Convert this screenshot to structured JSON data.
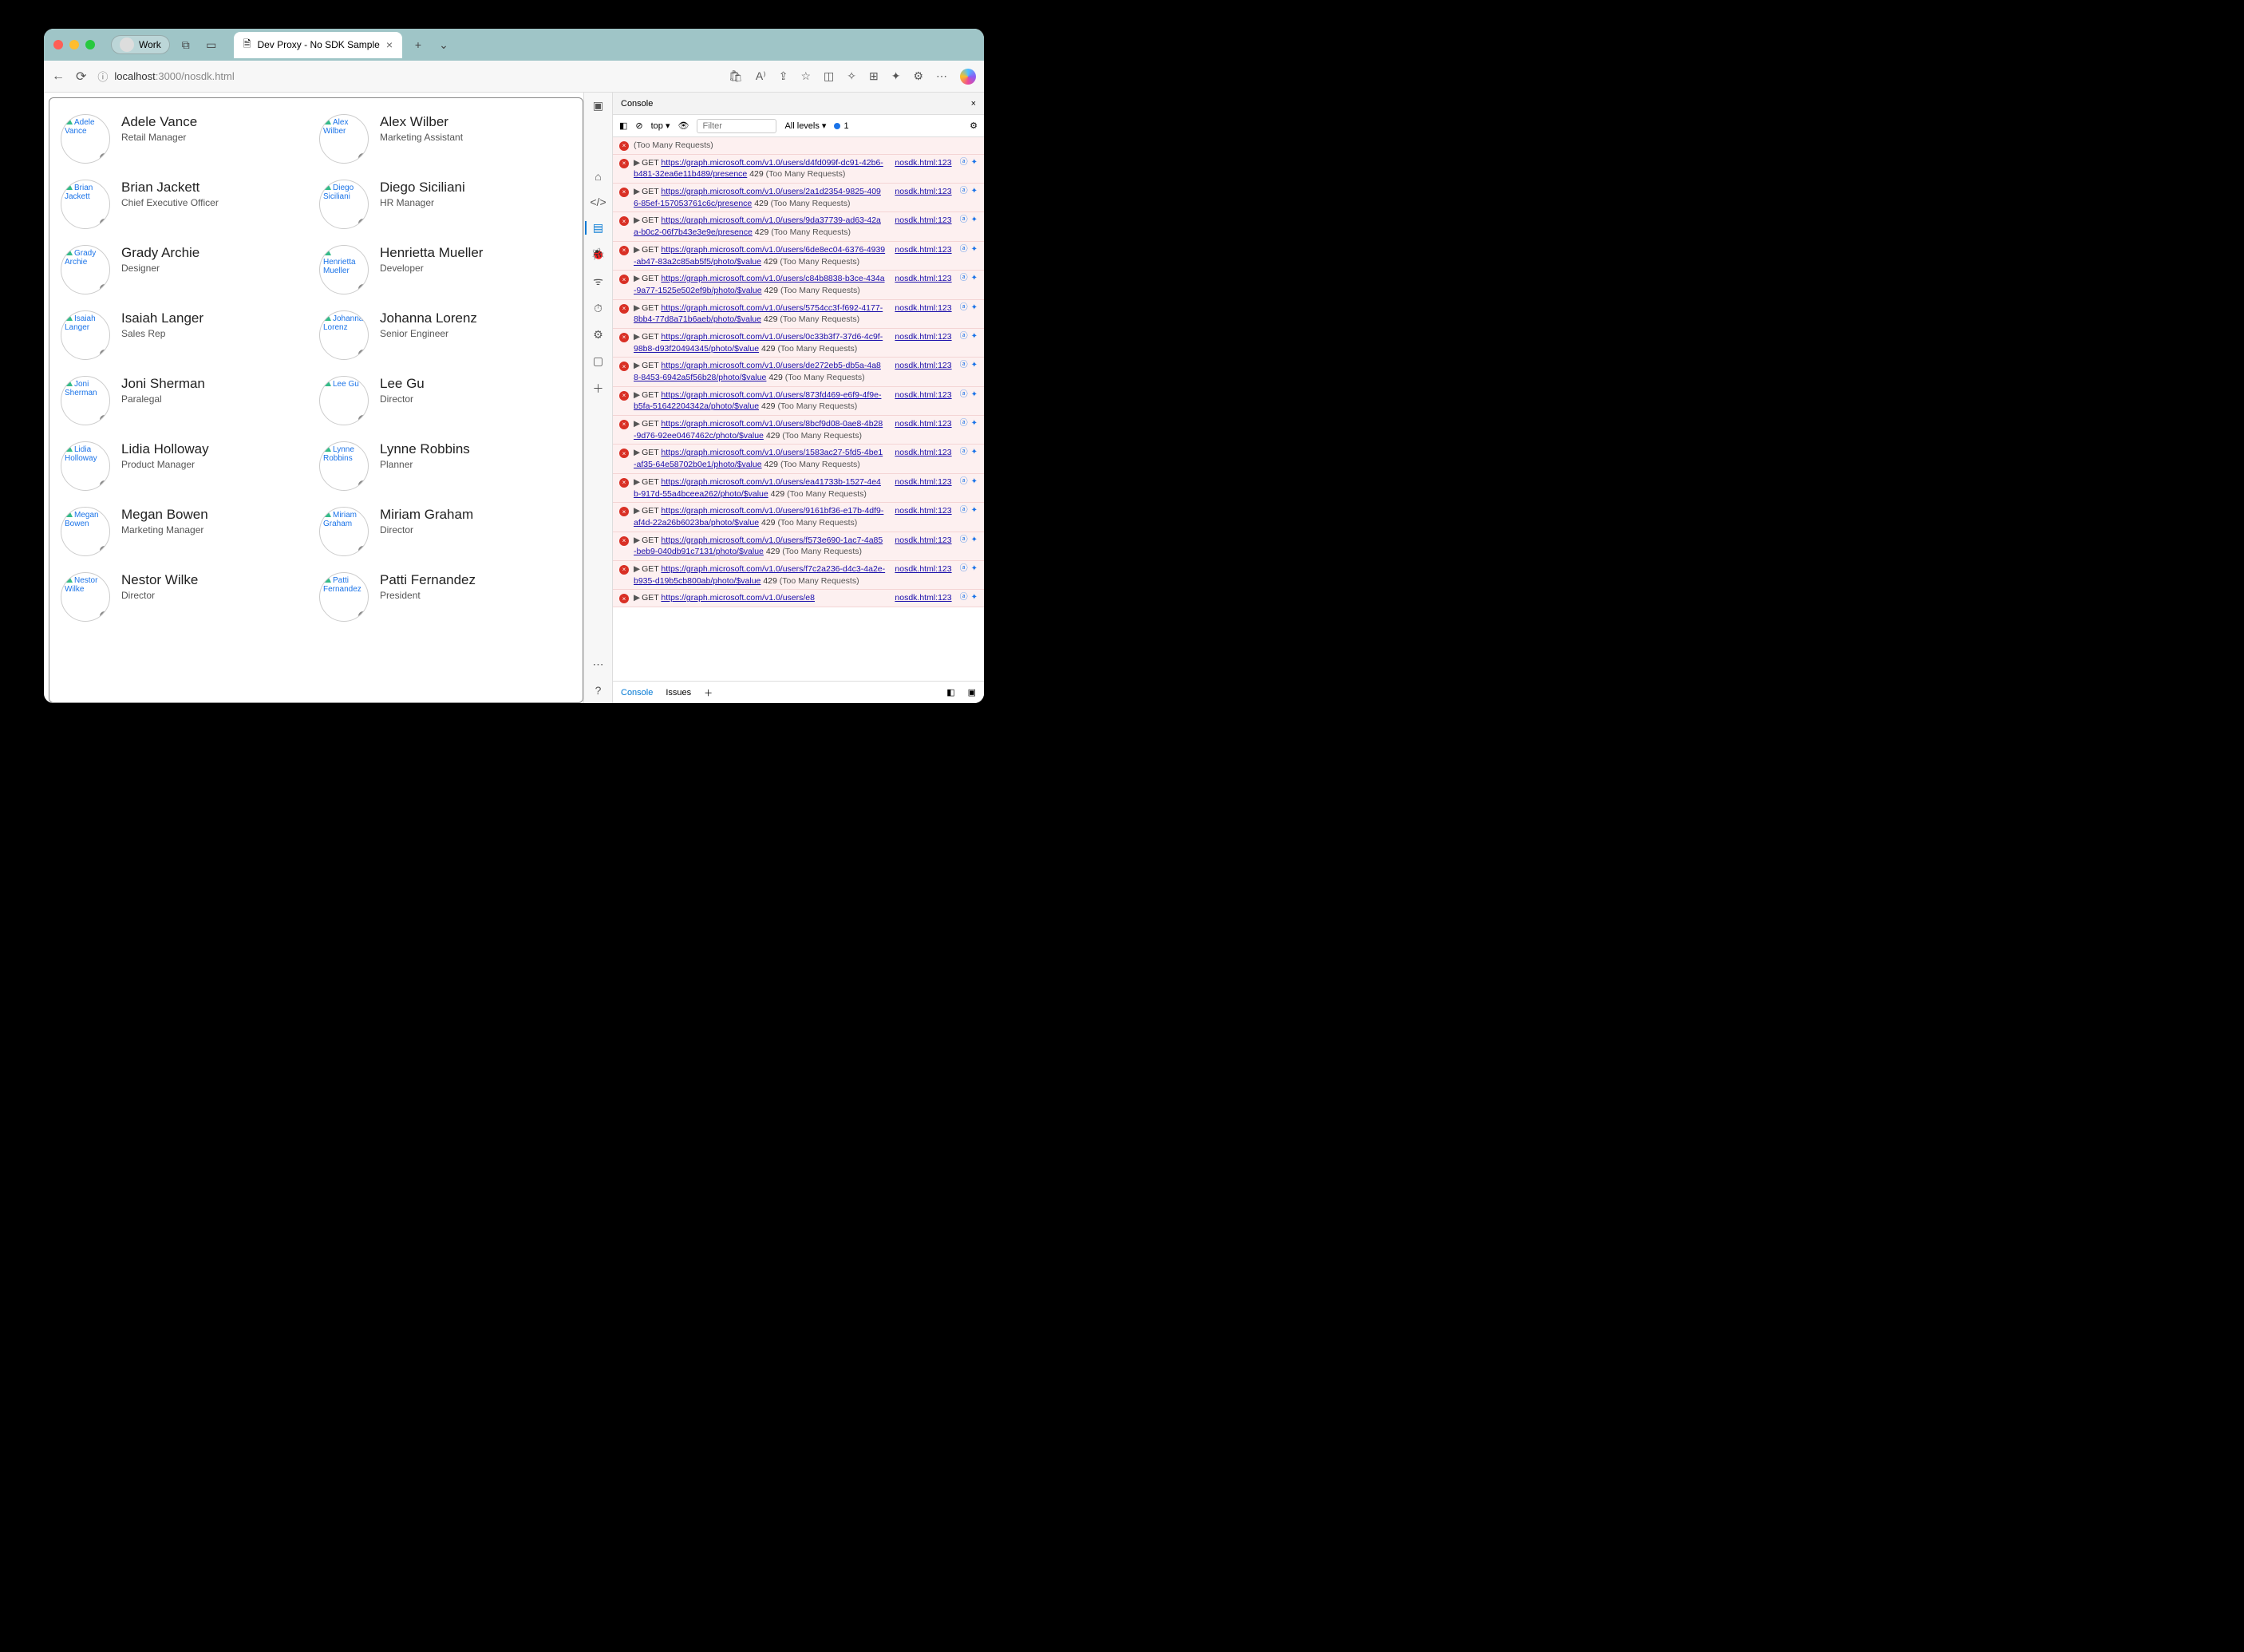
{
  "titlebar": {
    "work_label": "Work",
    "tab_title": "Dev Proxy - No SDK Sample",
    "new_tab": "+"
  },
  "url": {
    "host": "localhost",
    "port": ":3000",
    "path": "/nosdk.html"
  },
  "people": [
    {
      "name": "Adele Vance",
      "title": "Retail Manager",
      "alt": "Adele Vance"
    },
    {
      "name": "Alex Wilber",
      "title": "Marketing Assistant",
      "alt": "Alex Wilber"
    },
    {
      "name": "Brian Jackett",
      "title": "Chief Executive Officer",
      "alt": "Brian Jackett"
    },
    {
      "name": "Diego Siciliani",
      "title": "HR Manager",
      "alt": "Diego Siciliani"
    },
    {
      "name": "Grady Archie",
      "title": "Designer",
      "alt": "Grady Archie"
    },
    {
      "name": "Henrietta Mueller",
      "title": "Developer",
      "alt": "Henrietta Mueller"
    },
    {
      "name": "Isaiah Langer",
      "title": "Sales Rep",
      "alt": "Isaiah Langer"
    },
    {
      "name": "Johanna Lorenz",
      "title": "Senior Engineer",
      "alt": "Johanna Lorenz"
    },
    {
      "name": "Joni Sherman",
      "title": "Paralegal",
      "alt": "Joni Sherman"
    },
    {
      "name": "Lee Gu",
      "title": "Director",
      "alt": "Lee Gu"
    },
    {
      "name": "Lidia Holloway",
      "title": "Product Manager",
      "alt": "Lidia Holloway"
    },
    {
      "name": "Lynne Robbins",
      "title": "Planner",
      "alt": "Lynne Robbins"
    },
    {
      "name": "Megan Bowen",
      "title": "Marketing Manager",
      "alt": "Megan Bowen"
    },
    {
      "name": "Miriam Graham",
      "title": "Director",
      "alt": "Miriam Graham"
    },
    {
      "name": "Nestor Wilke",
      "title": "Director",
      "alt": "Nestor Wilke"
    },
    {
      "name": "Patti Fernandez",
      "title": "President",
      "alt": "Patti Fernandez"
    }
  ],
  "devtools": {
    "panel": "Console",
    "context": "top",
    "filter_placeholder": "Filter",
    "levels": "All levels ▾",
    "badge_count": "1",
    "footer": {
      "console": "Console",
      "issues": "Issues"
    },
    "first_tail": "(Too Many Requests)",
    "entries": [
      {
        "url": "https://graph.microsoft.com/v1.0/users/d4fd099f-dc91-42b6-b481-32ea6e11b489/presence",
        "code": "429",
        "msg": "(Too Many Requests)",
        "src": "nosdk.html:123"
      },
      {
        "url": "https://graph.microsoft.com/v1.0/users/2a1d2354-9825-4096-85ef-157053761c6c/presence",
        "code": "429",
        "msg": "(Too Many Requests)",
        "src": "nosdk.html:123"
      },
      {
        "url": "https://graph.microsoft.com/v1.0/users/9da37739-ad63-42aa-b0c2-06f7b43e3e9e/presence",
        "code": "429",
        "msg": "(Too Many Requests)",
        "src": "nosdk.html:123"
      },
      {
        "url": "https://graph.microsoft.com/v1.0/users/6de8ec04-6376-4939-ab47-83a2c85ab5f5/photo/$value",
        "code": "429",
        "msg": "(Too Many Requests)",
        "src": "nosdk.html:123"
      },
      {
        "url": "https://graph.microsoft.com/v1.0/users/c84b8838-b3ce-434a-9a77-1525e502ef9b/photo/$value",
        "code": "429",
        "msg": "(Too Many Requests)",
        "src": "nosdk.html:123"
      },
      {
        "url": "https://graph.microsoft.com/v1.0/users/5754cc3f-f692-4177-8bb4-77d8a71b6aeb/photo/$value",
        "code": "429",
        "msg": "(Too Many Requests)",
        "src": "nosdk.html:123"
      },
      {
        "url": "https://graph.microsoft.com/v1.0/users/0c33b3f7-37d6-4c9f-98b8-d93f20494345/photo/$value",
        "code": "429",
        "msg": "(Too Many Requests)",
        "src": "nosdk.html:123"
      },
      {
        "url": "https://graph.microsoft.com/v1.0/users/de272eb5-db5a-4a88-8453-6942a5f56b28/photo/$value",
        "code": "429",
        "msg": "(Too Many Requests)",
        "src": "nosdk.html:123"
      },
      {
        "url": "https://graph.microsoft.com/v1.0/users/873fd469-e6f9-4f9e-b5fa-51642204342a/photo/$value",
        "code": "429",
        "msg": "(Too Many Requests)",
        "src": "nosdk.html:123"
      },
      {
        "url": "https://graph.microsoft.com/v1.0/users/8bcf9d08-0ae8-4b28-9d76-92ee0467462c/photo/$value",
        "code": "429",
        "msg": "(Too Many Requests)",
        "src": "nosdk.html:123"
      },
      {
        "url": "https://graph.microsoft.com/v1.0/users/1583ac27-5fd5-4be1-af35-64e58702b0e1/photo/$value",
        "code": "429",
        "msg": "(Too Many Requests)",
        "src": "nosdk.html:123"
      },
      {
        "url": "https://graph.microsoft.com/v1.0/users/ea41733b-1527-4e4b-917d-55a4bceea262/photo/$value",
        "code": "429",
        "msg": "(Too Many Requests)",
        "src": "nosdk.html:123"
      },
      {
        "url": "https://graph.microsoft.com/v1.0/users/9161bf36-e17b-4df9-af4d-22a26b6023ba/photo/$value",
        "code": "429",
        "msg": "(Too Many Requests)",
        "src": "nosdk.html:123"
      },
      {
        "url": "https://graph.microsoft.com/v1.0/users/f573e690-1ac7-4a85-beb9-040db91c7131/photo/$value",
        "code": "429",
        "msg": "(Too Many Requests)",
        "src": "nosdk.html:123"
      },
      {
        "url": "https://graph.microsoft.com/v1.0/users/f7c2a236-d4c3-4a2e-b935-d19b5cb800ab/photo/$value",
        "code": "429",
        "msg": "(Too Many Requests)",
        "src": "nosdk.html:123"
      },
      {
        "url": "https://graph.microsoft.com/v1.0/users/e8",
        "code": "",
        "msg": "",
        "src": "nosdk.html:123"
      }
    ]
  }
}
